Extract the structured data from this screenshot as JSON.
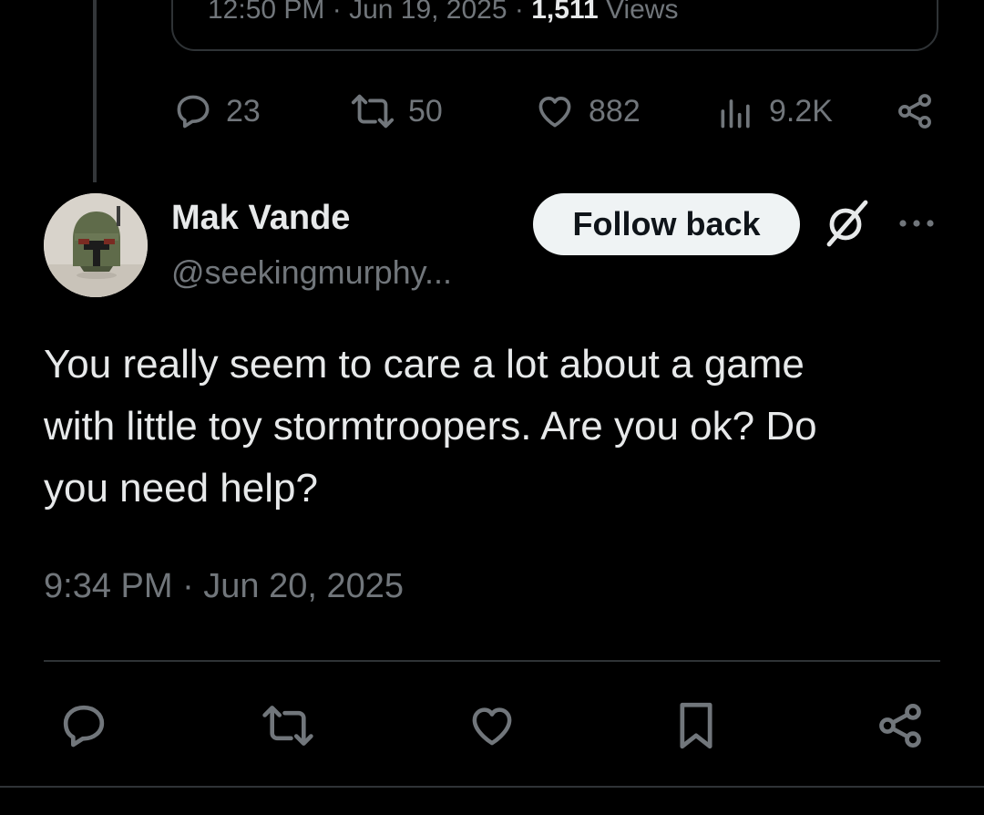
{
  "quoted_tweet": {
    "timestamp": "12:50 PM · Jun 19, 2025 · ",
    "views_count": "1,511",
    "views_label": " Views"
  },
  "parent_stats": {
    "replies": "23",
    "reposts": "50",
    "likes": "882",
    "views": "9.2K"
  },
  "reply": {
    "display_name": "Mak Vande",
    "handle": "@seekingmurphy...",
    "follow_button": "Follow back",
    "text": "You really seem to care a lot about a game\nwith little toy stormtroopers. Are you ok? Do\nyou need help?",
    "timestamp": "9:34 PM · Jun 20, 2025"
  },
  "icons": {
    "reply": "reply-icon",
    "repost": "repost-icon",
    "like": "heart-icon",
    "views": "views-chart-icon",
    "share": "share-icon",
    "grok": "grok-icon",
    "more": "more-dots-icon",
    "bookmark": "bookmark-icon"
  },
  "colors": {
    "background": "#000000",
    "text_primary": "#e7e9ea",
    "text_secondary": "#71767b",
    "divider": "#2f3336",
    "follow_button_bg": "#eff3f4"
  }
}
